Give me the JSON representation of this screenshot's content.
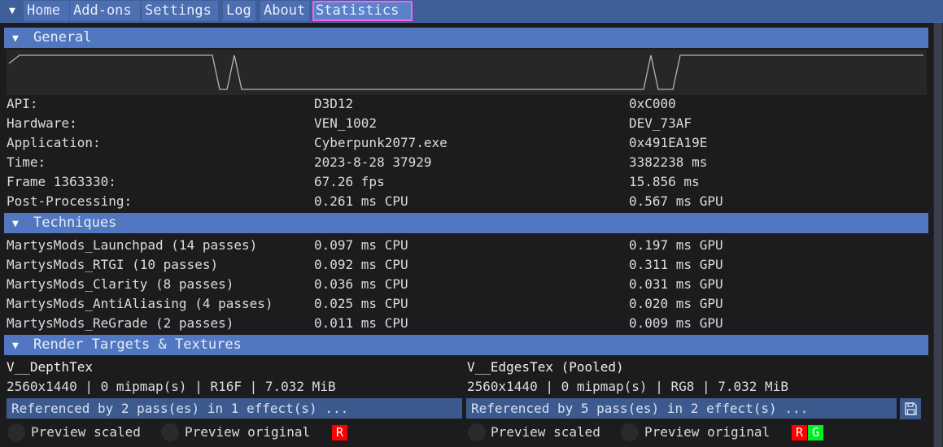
{
  "tabs": {
    "toggle_icon": "triangle-down",
    "items": [
      {
        "label": "Home"
      },
      {
        "label": "Add-ons"
      },
      {
        "label": "Settings"
      },
      {
        "label": "Log"
      },
      {
        "label": "About"
      },
      {
        "label": "Statistics",
        "active": true
      }
    ]
  },
  "general": {
    "title": "General",
    "frametime_graph": {
      "type": "line",
      "description": "frame time history (normalized)",
      "values": [
        0.7,
        1,
        1,
        1,
        1,
        1,
        1,
        1,
        1,
        1,
        1,
        0,
        0,
        1,
        0,
        0,
        0,
        0,
        0,
        0,
        0,
        0,
        0,
        0,
        0,
        0,
        0,
        0,
        0,
        0,
        0,
        1,
        0,
        0,
        1,
        1,
        1,
        1,
        1,
        1,
        1,
        1,
        1,
        1,
        1,
        1
      ]
    },
    "rows": [
      {
        "label": "API:",
        "value": "D3D12",
        "extra": "0xC000"
      },
      {
        "label": "Hardware:",
        "value": "VEN_1002",
        "extra": "DEV_73AF"
      },
      {
        "label": "Application:",
        "value": "Cyberpunk2077.exe",
        "extra": "0x491EA19E"
      },
      {
        "label": "Time:",
        "value": "2023-8-28 37929",
        "extra": "3382238 ms"
      },
      {
        "label": "Frame 1363330:",
        "value": "67.26 fps",
        "extra": "15.856 ms"
      },
      {
        "label": "Post-Processing:",
        "value": "0.261 ms CPU",
        "extra": "0.567 ms GPU"
      }
    ]
  },
  "techniques": {
    "title": "Techniques",
    "rows": [
      {
        "name": "MartysMods_Launchpad (14 passes)",
        "cpu": "0.097 ms CPU",
        "gpu": "0.197 ms GPU"
      },
      {
        "name": "MartysMods_RTGI (10 passes)",
        "cpu": "0.092 ms CPU",
        "gpu": "0.311 ms GPU"
      },
      {
        "name": "MartysMods_Clarity (8 passes)",
        "cpu": "0.036 ms CPU",
        "gpu": "0.031 ms GPU"
      },
      {
        "name": "MartysMods_AntiAliasing (4 passes)",
        "cpu": "0.025 ms CPU",
        "gpu": "0.020 ms GPU"
      },
      {
        "name": "MartysMods_ReGrade (2 passes)",
        "cpu": "0.011 ms CPU",
        "gpu": "0.009 ms GPU"
      }
    ]
  },
  "render_targets": {
    "title": "Render Targets & Textures",
    "items": [
      {
        "name": "V__DepthTex",
        "info": "2560x1440 | 0 mipmap(s) | R16F | 7.032 MiB",
        "references": "Referenced by 2 pass(es) in 1 effect(s) ...",
        "preview_scaled": "Preview scaled",
        "preview_original": "Preview original",
        "channels": [
          {
            "label": "R",
            "color": "#ff0000"
          }
        ]
      },
      {
        "name": "V__EdgesTex (Pooled)",
        "info": "2560x1440 | 0 mipmap(s) | RG8 | 7.032 MiB",
        "references": "Referenced by 5 pass(es) in 2 effect(s) ...",
        "preview_scaled": "Preview scaled",
        "preview_original": "Preview original",
        "channels": [
          {
            "label": "R",
            "color": "#ff0000"
          },
          {
            "label": "G",
            "color": "#00ee22"
          }
        ],
        "save_icon": "floppy-disk"
      }
    ]
  },
  "colors": {
    "header": "#5077bf",
    "active_tab_outline": "#ff5cf0",
    "background": "#1c1c1e"
  }
}
